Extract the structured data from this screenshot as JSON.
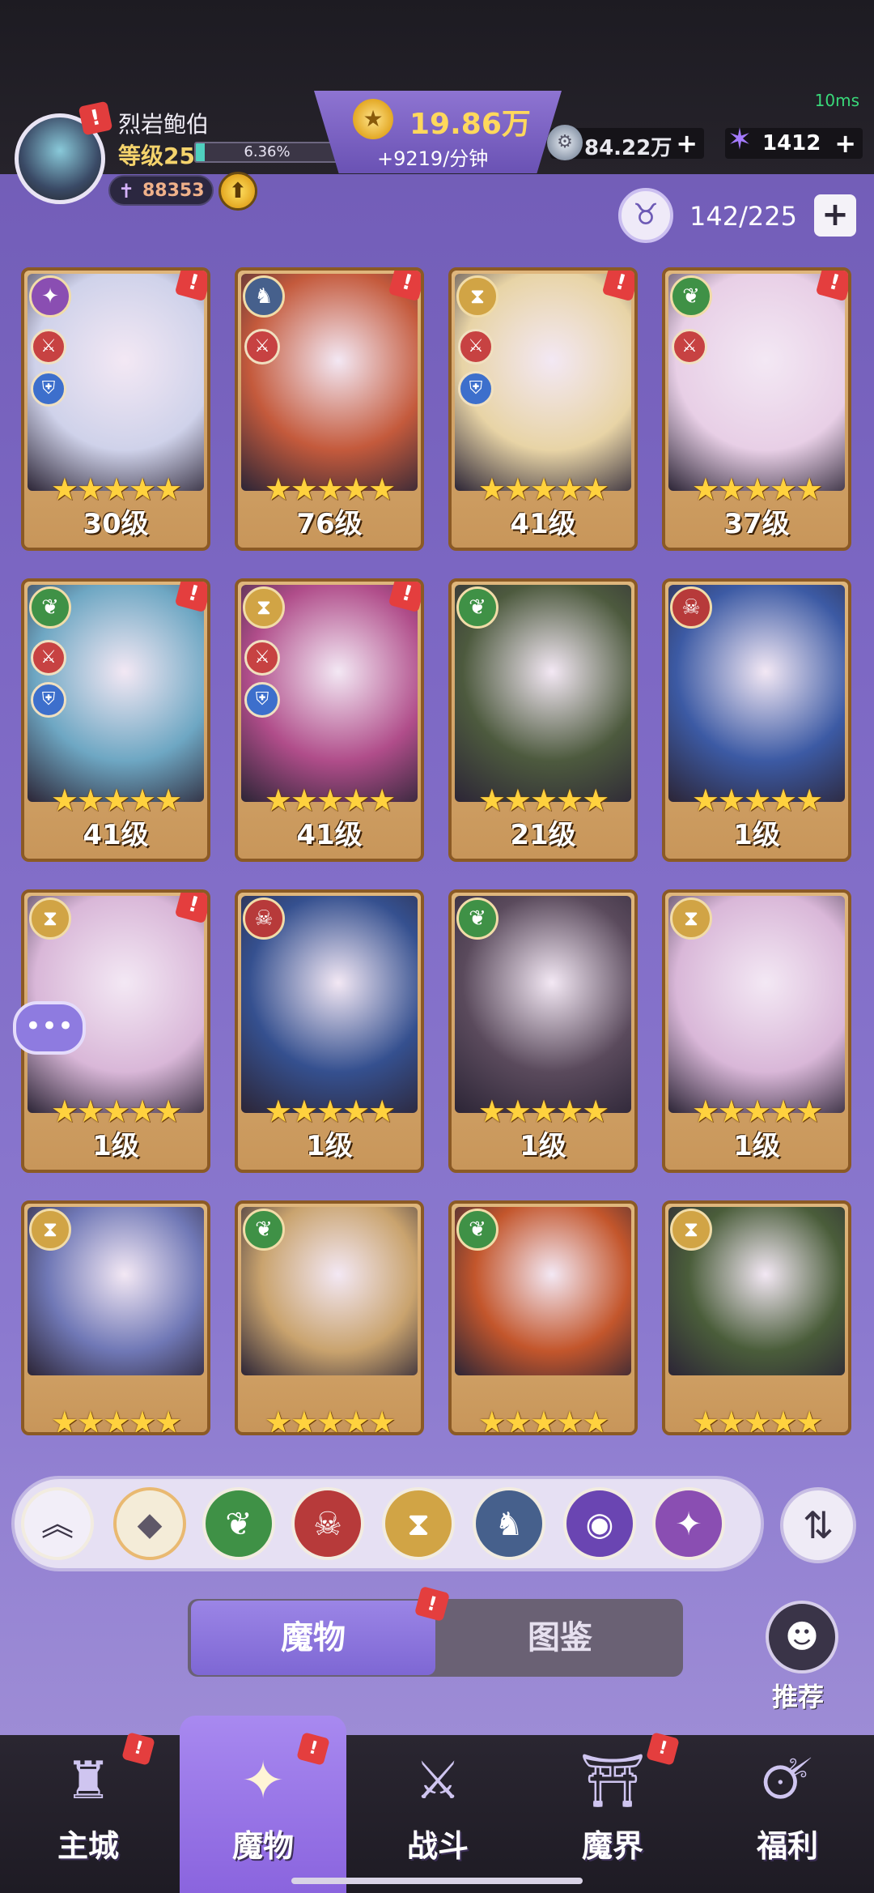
{
  "status": {
    "ping": "10ms"
  },
  "player": {
    "name": "烈岩鲍伯",
    "level": "等级25",
    "exp_percent": "6.36%",
    "exp_fraction": 0.0636,
    "power": "88353",
    "alert": "!"
  },
  "gold": {
    "amount": "19.86万",
    "rate": "+9219/分钟"
  },
  "currencies": [
    {
      "icon": "silver-coin-icon",
      "value": "84.22万",
      "plus": "+"
    },
    {
      "icon": "star-crystal-icon",
      "value": "1412",
      "plus": "+"
    }
  ],
  "capacity": {
    "value": "142/225",
    "plus": "+"
  },
  "cards": [
    {
      "level": "30级",
      "element": "chaos",
      "badge": true,
      "sub1": true,
      "sub2": true,
      "art": "#cfd2ea"
    },
    {
      "level": "76级",
      "element": "dragon",
      "badge": true,
      "sub1": true,
      "sub2": false,
      "art": "#c45a3c"
    },
    {
      "level": "41级",
      "element": "time",
      "badge": true,
      "sub1": true,
      "sub2": true,
      "art": "#e8d4a6"
    },
    {
      "level": "37级",
      "element": "nature",
      "badge": true,
      "sub1": true,
      "sub2": false,
      "art": "#e8cfe6"
    },
    {
      "level": "41级",
      "element": "nature",
      "badge": true,
      "sub1": true,
      "sub2": true,
      "art": "#6ea7c3"
    },
    {
      "level": "41级",
      "element": "time",
      "badge": true,
      "sub1": true,
      "sub2": true,
      "art": "#b04d8a"
    },
    {
      "level": "21级",
      "element": "nature",
      "badge": false,
      "sub1": false,
      "sub2": false,
      "art": "#4d5a3e"
    },
    {
      "level": "1级",
      "element": "demon",
      "badge": false,
      "sub1": false,
      "sub2": false,
      "art": "#3c5aa4"
    },
    {
      "level": "1级",
      "element": "time",
      "badge": true,
      "sub1": false,
      "sub2": false,
      "art": "#d9b7d8"
    },
    {
      "level": "1级",
      "element": "demon",
      "badge": false,
      "sub1": false,
      "sub2": false,
      "art": "#35508f"
    },
    {
      "level": "1级",
      "element": "nature",
      "badge": false,
      "sub1": false,
      "sub2": false,
      "art": "#5a4a5c"
    },
    {
      "level": "1级",
      "element": "time",
      "badge": false,
      "sub1": false,
      "sub2": false,
      "art": "#d9b7d8"
    },
    {
      "level": "",
      "element": "time",
      "badge": false,
      "sub1": false,
      "sub2": false,
      "art": "#7078b6"
    },
    {
      "level": "",
      "element": "nature",
      "badge": false,
      "sub1": false,
      "sub2": false,
      "art": "#c9a36e"
    },
    {
      "level": "",
      "element": "nature",
      "badge": false,
      "sub1": false,
      "sub2": false,
      "art": "#c3562c"
    },
    {
      "level": "",
      "element": "time",
      "badge": false,
      "sub1": false,
      "sub2": false,
      "art": "#4a5d3a"
    }
  ],
  "stars": "★★★★★",
  "filters": [
    {
      "name": "collapse",
      "glyph": "︽",
      "bg": "#f2eef8",
      "color": "#3a3346"
    },
    {
      "name": "all",
      "glyph": "◆",
      "bg": "#f4ecd8",
      "color": "#5f5868"
    },
    {
      "name": "nature",
      "glyph": "❦",
      "bg": "#3f9146",
      "color": "#ffffff"
    },
    {
      "name": "demon",
      "glyph": "☠",
      "bg": "#b73a3a",
      "color": "#ffffff"
    },
    {
      "name": "time",
      "glyph": "⧗",
      "bg": "#d1a445",
      "color": "#ffffff"
    },
    {
      "name": "dragon",
      "glyph": "♞",
      "bg": "#46608c",
      "color": "#ffffff"
    },
    {
      "name": "eye",
      "glyph": "◉",
      "bg": "#6a45b2",
      "color": "#ffffff"
    },
    {
      "name": "chaos",
      "glyph": "✦",
      "bg": "#8a4eb2",
      "color": "#ffffff"
    }
  ],
  "sort_glyph": "⇅",
  "tabs": {
    "active": "魔物",
    "inactive": "图鉴"
  },
  "recommend": {
    "label": "推荐"
  },
  "nav": [
    {
      "label": "主城",
      "icon": "castle-icon",
      "glyph": "♜",
      "badge": true
    },
    {
      "label": "魔物",
      "icon": "monster-icon",
      "glyph": "✦",
      "badge": true
    },
    {
      "label": "战斗",
      "icon": "sword-icon",
      "glyph": "⚔",
      "badge": false
    },
    {
      "label": "魔界",
      "icon": "portal-icon",
      "glyph": "⛩",
      "badge": true
    },
    {
      "label": "福利",
      "icon": "chest-icon",
      "glyph": "🜚",
      "badge": false
    }
  ],
  "element_colors": {
    "chaos": "#8a4eb2",
    "dragon": "#46608c",
    "time": "#d1a445",
    "nature": "#3f9146",
    "demon": "#b73a3a"
  },
  "element_glyphs": {
    "chaos": "✦",
    "dragon": "♞",
    "time": "⧗",
    "nature": "❦",
    "demon": "☠"
  }
}
